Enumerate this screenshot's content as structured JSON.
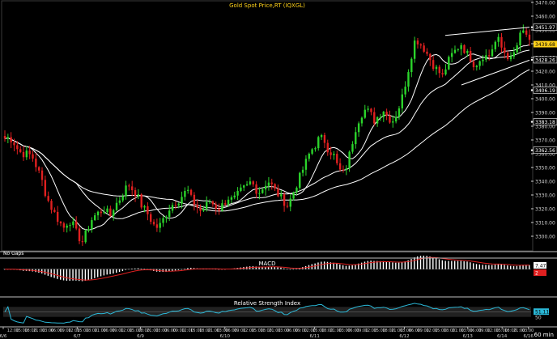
{
  "colors": {
    "background": "#000000",
    "up": "#2bd42b",
    "down": "#e02020",
    "title": "#ffd21a",
    "ma": "#ffffff",
    "macd_signal": "#e02020",
    "rsi_line": "#2ab7d6",
    "rsi_band": "#4a4a4a",
    "axis": "#d0d0d0",
    "label_white": "#ffffff",
    "label_yellow": "#ffd21a",
    "label_green": "#2bd42b",
    "label_red": "#e02020",
    "label_cyan": "#2ab7d6"
  },
  "price_panel": {
    "title": "Gold  Spot  Price,RT  (IQXGL)",
    "no_gaps": "No Gaps",
    "price_tag": "3439.68",
    "level_tags": [
      "3451.97",
      "3428.26",
      "3406.19",
      "3383.18",
      "3362.56"
    ]
  },
  "macd_panel": {
    "title": "MACD",
    "tags": [
      "7.47",
      "2"
    ]
  },
  "rsi_panel": {
    "title": "Relative  Strength  Index",
    "tags": [
      "51.11",
      "50"
    ]
  },
  "footer": {
    "unit": "60 min"
  },
  "chart_data": {
    "type": "candlestick",
    "interval": "60 min",
    "title": "Gold  Spot  Price,RT  (IQXGL)",
    "ylim": [
      3290,
      3470
    ],
    "yticks": [
      3300,
      3310,
      3320,
      3330,
      3340,
      3350,
      3360,
      3370,
      3380,
      3390,
      3400,
      3410,
      3420,
      3430,
      3440,
      3450,
      3460,
      3470
    ],
    "date_labels": [
      "6/6",
      "6/7",
      "6/9",
      "6/10",
      "6/11",
      "6/12",
      "6/13",
      "6/14",
      "6/16"
    ],
    "time_labels": [
      "12:00",
      "15:00",
      "18:00",
      "21:00",
      "03:00",
      "06:00",
      "09:00",
      "12:00",
      "15:00",
      "18:00",
      "21:00",
      "06:00",
      "09:00",
      "12:00",
      "15:00",
      "18:00",
      "21:00",
      "03:00",
      "06:00",
      "09:00",
      "12:00",
      "15:00",
      "18:00",
      "21:00",
      "03:00",
      "06:00",
      "09:00",
      "12:00",
      "15:00",
      "18:00",
      "21:00",
      "03:00",
      "06:00",
      "09:00",
      "12:00",
      "15:00",
      "18:00",
      "21:00",
      "03:00",
      "06:00",
      "09:00",
      "12:00",
      "15:00",
      "18:00",
      "21:00",
      "03:00",
      "06:00",
      "09:00",
      "12:00",
      "15:00",
      "18:00",
      "21:00",
      "03:00",
      "06:00",
      "09:00",
      "12:00",
      "15:00",
      "18:00",
      "21:00",
      "03:00"
    ],
    "price_path": [
      3371,
      3372,
      3368,
      3362,
      3360,
      3360,
      3358,
      3350,
      3342,
      3330,
      3322,
      3316,
      3310,
      3306,
      3312,
      3308,
      3300,
      3296,
      3304,
      3312,
      3316,
      3318,
      3320,
      3314,
      3322,
      3326,
      3332,
      3338,
      3334,
      3330,
      3322,
      3318,
      3312,
      3306,
      3308,
      3314,
      3320,
      3324,
      3326,
      3330,
      3334,
      3326,
      3322,
      3318,
      3322,
      3326,
      3322,
      3320,
      3324,
      3328,
      3326,
      3330,
      3334,
      3336,
      3340,
      3334,
      3332,
      3338,
      3340,
      3334,
      3330,
      3326,
      3322,
      3330,
      3338,
      3346,
      3354,
      3362,
      3366,
      3372,
      3370,
      3362,
      3360,
      3350,
      3345,
      3352,
      3366,
      3380,
      3388,
      3392,
      3390,
      3384,
      3388,
      3392,
      3386,
      3384,
      3390,
      3400,
      3414,
      3430,
      3444,
      3440,
      3436,
      3430,
      3424,
      3420,
      3416,
      3426,
      3432,
      3436,
      3440,
      3434,
      3430,
      3424,
      3428,
      3432,
      3430,
      3438,
      3444,
      3436,
      3432,
      3428,
      3436,
      3446,
      3450,
      3440
    ],
    "levels": [
      3451.97,
      3428.26,
      3406.19,
      3383.18,
      3362.56
    ],
    "last_price": 3439.68,
    "macd": {
      "ylim": [
        -16,
        12
      ],
      "value": 7.47,
      "signal": 2
    },
    "rsi": {
      "ylim": [
        0,
        100
      ],
      "band": [
        30,
        70
      ],
      "value": 51.11,
      "mid": 50
    }
  }
}
